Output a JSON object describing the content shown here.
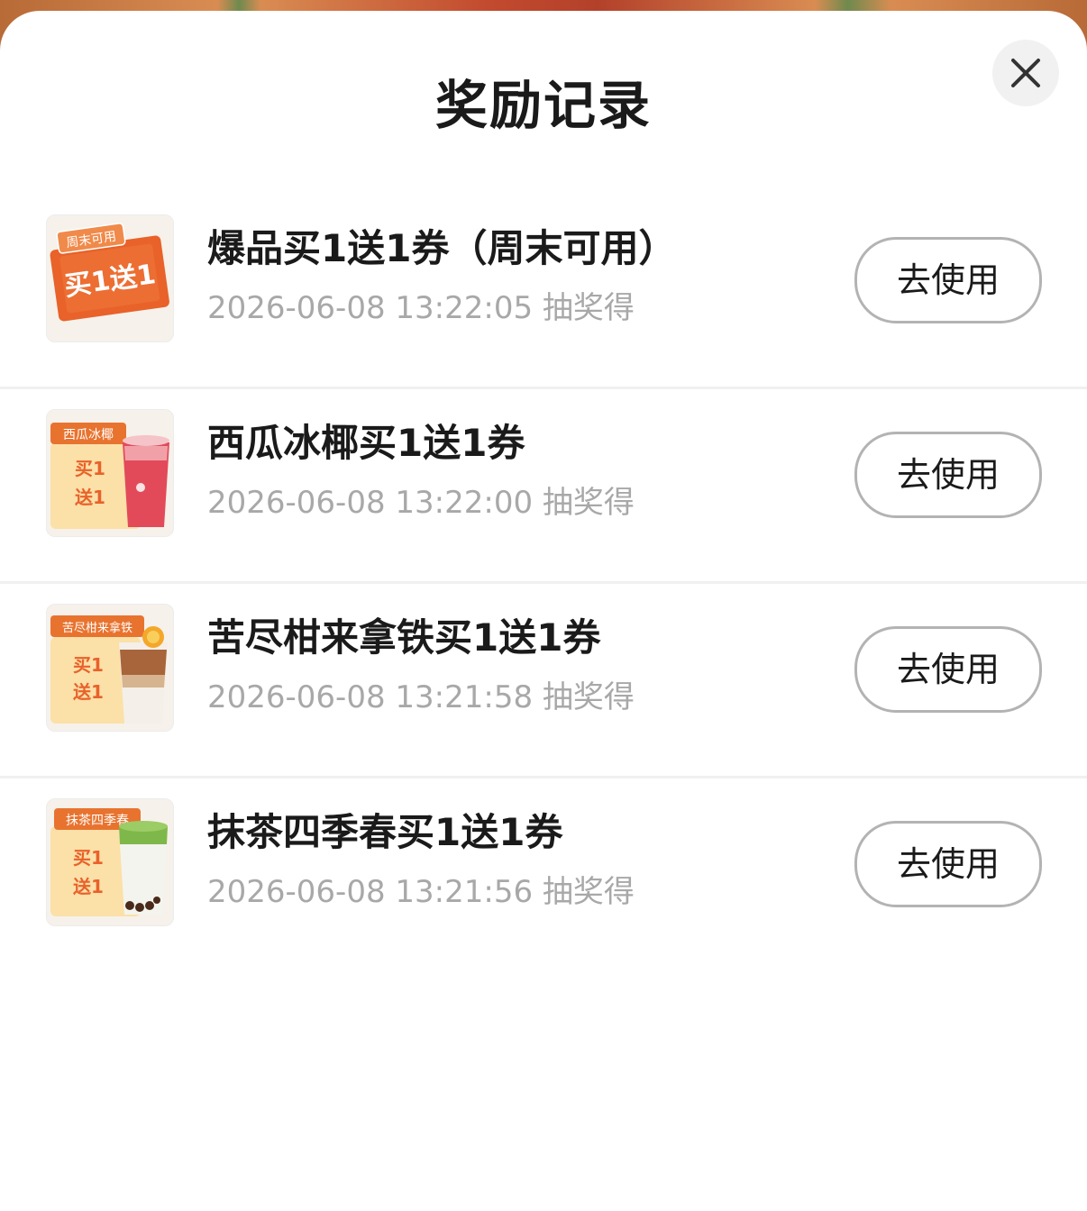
{
  "sheet": {
    "title": "奖励记录",
    "close_icon": "close-icon"
  },
  "rewards": [
    {
      "name": "爆品买1送1券（周末可用）",
      "meta": "2026-06-08 13:22:05 抽奖得",
      "button_label": "去使用",
      "thumb": {
        "tag": "周末可用",
        "main": "买1送1",
        "icon": "coupon-weekend-icon"
      }
    },
    {
      "name": "西瓜冰椰买1送1券",
      "meta": "2026-06-08 13:22:00 抽奖得",
      "button_label": "去使用",
      "thumb": {
        "tag": "西瓜冰椰",
        "line1": "买1",
        "line2": "送1",
        "icon": "watermelon-drink-coupon-icon"
      }
    },
    {
      "name": "苦尽柑来拿铁买1送1券",
      "meta": "2026-06-08 13:21:58 抽奖得",
      "button_label": "去使用",
      "thumb": {
        "tag": "苦尽柑来拿铁",
        "line1": "买1",
        "line2": "送1",
        "icon": "orange-latte-coupon-icon"
      }
    },
    {
      "name": "抹茶四季春买1送1券",
      "meta": "2026-06-08 13:21:56 抽奖得",
      "button_label": "去使用",
      "thumb": {
        "tag": "抹茶四季春",
        "line1": "买1",
        "line2": "送1",
        "icon": "matcha-tea-coupon-icon"
      }
    }
  ],
  "colors": {
    "coupon_orange": "#e8622a",
    "coupon_light": "#fbe0a8",
    "meta_gray": "#a8a8a8",
    "button_border": "#b3b3b3"
  }
}
